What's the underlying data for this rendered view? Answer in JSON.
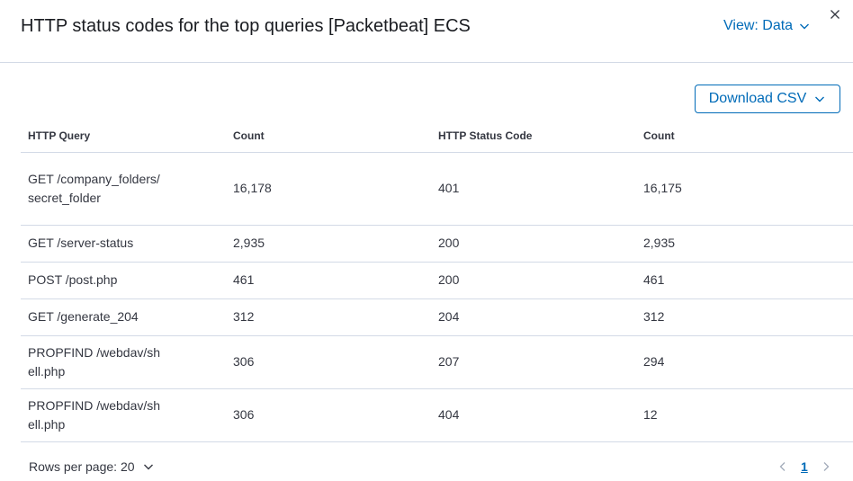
{
  "header": {
    "title": "HTTP status codes for the top queries [Packetbeat] ECS",
    "view_label": "View: Data"
  },
  "toolbar": {
    "download_label": "Download CSV"
  },
  "table": {
    "columns": [
      "HTTP Query",
      "Count",
      "HTTP Status Code",
      "Count"
    ],
    "rows": [
      [
        "GET /company_folders/secret_folder",
        "16,178",
        "401",
        "16,175"
      ],
      [
        "GET /server-status",
        "2,935",
        "200",
        "2,935"
      ],
      [
        "POST /post.php",
        "461",
        "200",
        "461"
      ],
      [
        "GET /generate_204",
        "312",
        "204",
        "312"
      ],
      [
        "PROPFIND /webdav/shell.php",
        "306",
        "207",
        "294"
      ],
      [
        "PROPFIND /webdav/shell.php",
        "306",
        "404",
        "12"
      ]
    ]
  },
  "footer": {
    "rows_per_page_label": "Rows per page: 20",
    "current_page": "1"
  },
  "icons": {
    "view": "chevron-down-icon",
    "close": "close-icon",
    "download": "chevron-down-icon",
    "rows": "chevron-down-icon",
    "prev": "chevron-left-icon",
    "next": "chevron-right-icon"
  },
  "colors": {
    "accent": "#006bb8",
    "border": "#d3dae6",
    "text": "#343741",
    "disabled": "#a2abba"
  }
}
